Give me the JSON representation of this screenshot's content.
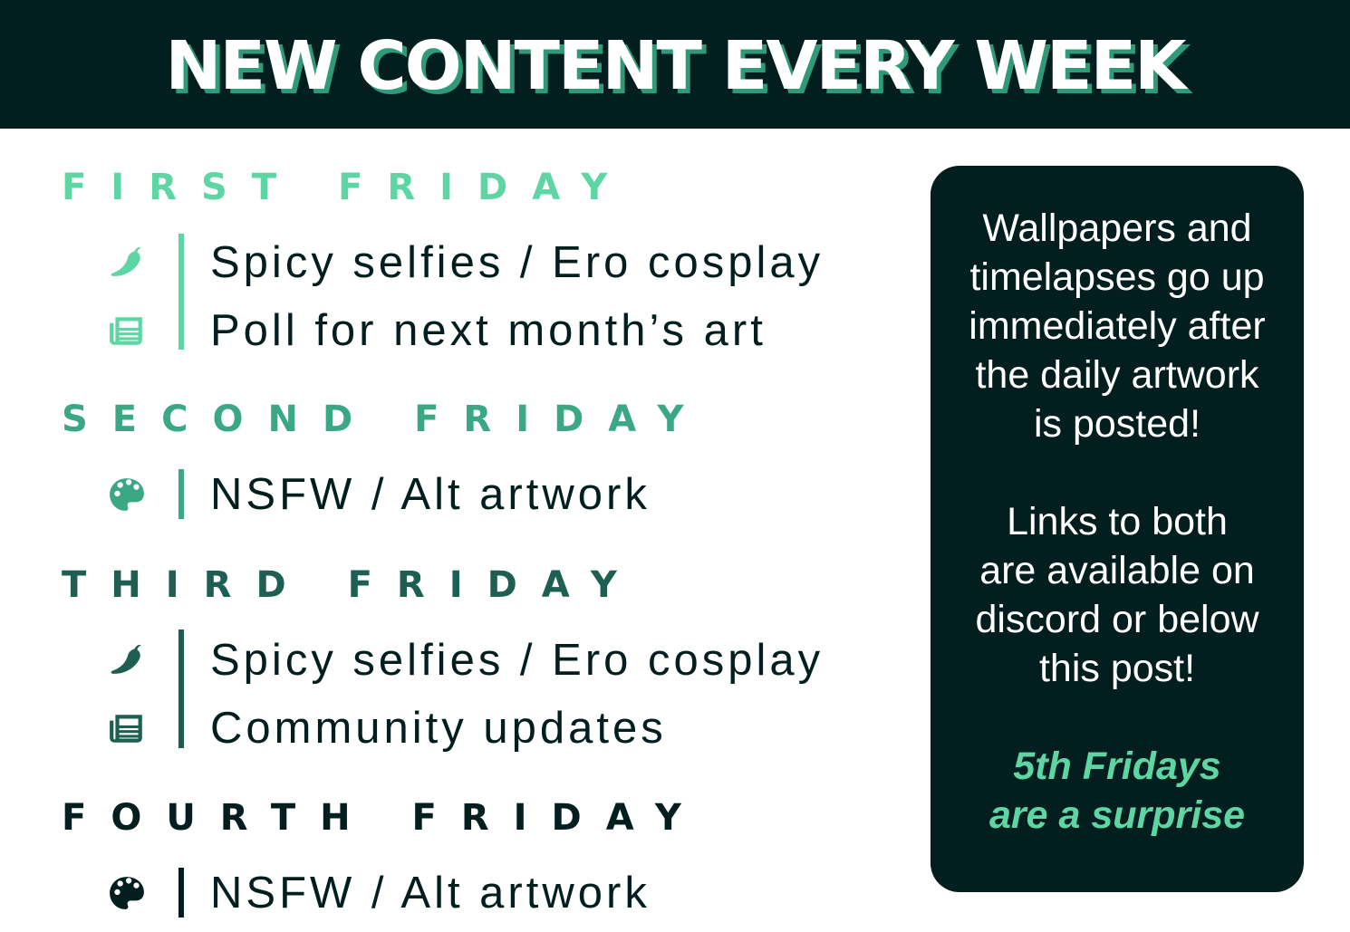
{
  "header": {
    "title": "NEW CONTENT EVERY WEEK"
  },
  "schedule": [
    {
      "title": "FIRST FRIDAY",
      "color": "#5ed6a3",
      "items": [
        {
          "icon": "pepper-icon",
          "label": "Spicy selfies / Ero cosplay"
        },
        {
          "icon": "newspaper-icon",
          "label": "Poll for next month’s art"
        }
      ]
    },
    {
      "title": "SECOND FRIDAY",
      "color": "#3aa882",
      "items": [
        {
          "icon": "palette-icon",
          "label": "NSFW / Alt artwork"
        }
      ]
    },
    {
      "title": "THIRD FRIDAY",
      "color": "#1d5f52",
      "items": [
        {
          "icon": "pepper-icon",
          "label": "Spicy selfies / Ero cosplay"
        },
        {
          "icon": "newspaper-icon",
          "label": "Community updates"
        }
      ]
    },
    {
      "title": "FOURTH FRIDAY",
      "color": "#021e1e",
      "items": [
        {
          "icon": "palette-icon",
          "label": "NSFW / Alt artwork"
        }
      ]
    }
  ],
  "info": {
    "paragraph1": [
      "Wallpapers and",
      "timelapses go up",
      "immediately after",
      "the daily artwork",
      "is posted!"
    ],
    "paragraph2": [
      "Links to both",
      "are available on",
      "discord or below",
      "this post!"
    ],
    "accent": [
      "5th Fridays",
      "are a surprise"
    ],
    "accent_color": "#5ed6a3"
  },
  "colors": {
    "dark": "#021e1e",
    "shadow": "#2f9a78"
  }
}
